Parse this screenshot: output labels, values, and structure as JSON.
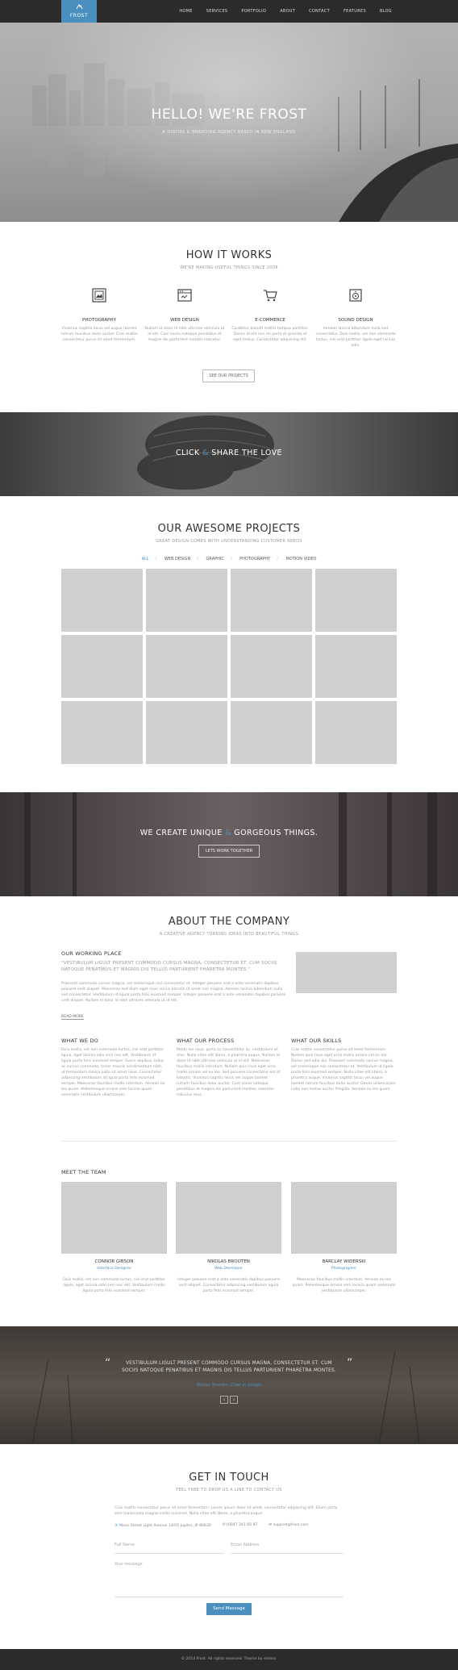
{
  "nav": {
    "logo": "FROST",
    "links": [
      "HOME",
      "SERVICES",
      "PORTFOLIO",
      "ABOUT",
      "CONTACT",
      "FEATURES",
      "BLOG"
    ]
  },
  "hero": {
    "title": "HELLO! WE'RE FROST",
    "subtitle": "A DIGITAL & BRANDING AGENCY BASED IN NEW ENGLAND"
  },
  "how": {
    "title": "HOW IT WORKS",
    "subtitle": "WE'RE MAKING USEFUL THINGS SINCE 2008",
    "services": [
      {
        "icon": "photo-icon",
        "title": "PHOTOGRAPHY",
        "desc": "Vivamus sagittis lacus vel augue laoreet rutrum faucibus dolor auctor. Cras mattis consectetur purus sit amet fermentum."
      },
      {
        "icon": "browser-icon",
        "title": "WEB DESIGN",
        "desc": "Nullam id dolor id nibh ultricies vehicula ut id elit. Cum sociis natoque penatibus et magnis dis parturient montes nascetur."
      },
      {
        "icon": "cart-icon",
        "title": "E-COMMERCE",
        "desc": "Curabitur blandit mattis tempus porttitor. Donec id elit non mi porta et gravida at eget metus. Consectetur adipiscing elit."
      },
      {
        "icon": "speaker-icon",
        "title": "SOUND DESIGN",
        "desc": "Aenean lacinia bibendum nulla sed consectetur. Duis mollis, est non commodo luctus, nisi erat porttitor ligula eget lacinia odio."
      }
    ],
    "button": "SEE OUR PROJECTS"
  },
  "share": {
    "text_a": "CLICK ",
    "amp": "&",
    "text_b": " SHARE THE LOVE"
  },
  "projects": {
    "title": "OUR AWESOME PROJECTS",
    "subtitle": "GREAT DESIGN COMES WITH UNDERSTANDING CUSTOMER NEEDS",
    "filters": [
      "ALL",
      "WEB DESIGN",
      "GRAPHIC",
      "PHOTOGRAPHY",
      "MOTION VIDEO"
    ],
    "active_filter": "ALL"
  },
  "unique": {
    "text_a": "WE CREATE UNIQUE ",
    "amp": "&",
    "text_b": " GORGEOUS THINGS.",
    "button": "LETS WORK TOGETHER"
  },
  "about": {
    "title": "ABOUT THE COMPANY",
    "subtitle": "A CREATIVE AGENCY TURNING IDEAS INTO BEAUTIFUL THINGS",
    "working_title": "OUR WORKING PLACE",
    "working_quote": "\"VESTIBULUM LIGULT PRESENT COMMODO CURSUS MAGNA, CONSECTETUR ET. CUM SOCIIS NATOQUE PENATIBUS ET MAGNIS DIS TELLUS PARTURIENT PHARETRA MONTES.\"",
    "working_text": "Praesent commodo cursus magna, vel scelerisque nisl consectetur et. Integer posuere erat a ante venenatis dapibus posuere velit aliquet. Maecenas sed diam eget risus varius blandit sit amet non magna. Aenean lacinia bibendum nulla sed consectetur. Vestibulum id ligula porta felis euismod semper. Integer posuere erat a ante venenatis dapibus posuere velit aliquet. Nullam id dolor id nibh ultricies vehicula ut id elit.",
    "read_more": "READ MORE",
    "cols": [
      {
        "title": "WHAT WE DO",
        "text": "Duis mollis, est non commodo luctus, nisi erat porttitor ligula, eget lacinia odio sem nec elit. Vestibulum id ligula porta felis euismod semper. Fusce dapibus, tellus ac cursus commodo, tortor mauris condimentum nibh, ut fermentum massa justo sit amet risus. Consectetur adipiscing vestibulum id ligula porta felis euismod semper. Maecenas faucibus mollis interdum. Aenean eu leo quam. Pellentesque ornare sem lacinia quam venenatis vestibulum ullamcorper."
      },
      {
        "title": "WHAT OUR PROCESS",
        "text": "Morbi leo risus, porta ac consectetur ac, vestibulum at eros. Nulla vitae elit libero, a pharetra augue. Nullam id dolor id nibh ultricies vehicula ut id elit. Maecenas faucibus mollis interdum. Nullam quis risus eget urna mollis ornare vel eu leo. Sed posuere consectetur est at lobortis. Vivamus sagittis lacus vel augue laoreet rutrum faucibus dolor auctor. Cum sociis natoque penatibus et magnis dis parturient montes, nascetur ridiculus mus."
      },
      {
        "title": "WHAT OUR SKILLS",
        "text": "Cras mattis consectetur purus sit amet fermentum. Nullam quis risus eget urna mollis ornare vel eu leo. Donec sed odio dui. Praesent commodo cursus magna, vel scelerisque nisl consectetur et. Vestibulum id ligula porta felis euismod semper. Nulla vitae elit libero, a pharetra augue. Vivamus sagittis lacus vel augue laoreet rutrum faucibus dolor auctor. Donec ullamcorper nulla non metus auctor fringilla. Aenean eu leo quam."
      }
    ]
  },
  "team": {
    "title": "MEET THE TEAM",
    "members": [
      {
        "name": "CONNOR GIBSON",
        "role": "Interface Designer",
        "bio": "Duis mollis, est non commodo luctus, nisi erat porttitor ligula, eget lacinia odio sem nec elit. Vestibulum mollis ligula porta felis euismod semper."
      },
      {
        "name": "NIKOLAS BROOTEN",
        "role": "Web Developer",
        "bio": "Integer posuere erat a ante venenatis dapibus posuere velit aliquet. Consectetur adipiscing vestibulum ligula porta felis euismod semper."
      },
      {
        "name": "BARCLAY WIDERSKI",
        "role": "Photographer",
        "bio": "Maecenas faucibus mollis interdum. Aenean eu leo quam. Pellentesque ornare sem lacinia quam venenatis vestibulum ullamcorper."
      }
    ]
  },
  "testimonial": {
    "quote": "VESTIBULUM LIGULT PRESENT COMMODO CURSUS MAGNA, CONSECTETUR ET. CUM SOCIIS NATOQUE PENATIBUS ET MAGNIS DIS TELLUS PARTURIENT PHARETRA MONTES.",
    "author": "Nikolas Brooten, Chief at Google",
    "prev": "‹",
    "next": "›"
  },
  "contact": {
    "title": "GET IN TOUCH",
    "subtitle": "FEEL FREE TO DROP US A LINE TO CONTACT US",
    "text": "Cras mattis consectetur purus sit amet fermentum. Lorem ipsum dolor sit amet, consectetur adipiscing elit. Etiam porta sem malesuada magna mollis euismod. Nulla vitae elit libero, a pharetra augue.",
    "address": "Moon Street Light Avenue 14/05 Jupiter, JP 80630",
    "phone": "(0047 341 65 87",
    "email": "support@frost.com",
    "name_placeholder": "Full Name",
    "email_placeholder": "Email Address",
    "message_placeholder": "Your message",
    "send": "Send Message"
  },
  "footer": {
    "text": "© 2014 Frost. All rights reserved. Theme by elemis."
  },
  "colors": {
    "accent": "#4b8fbe",
    "dark": "#2b2b2b"
  }
}
